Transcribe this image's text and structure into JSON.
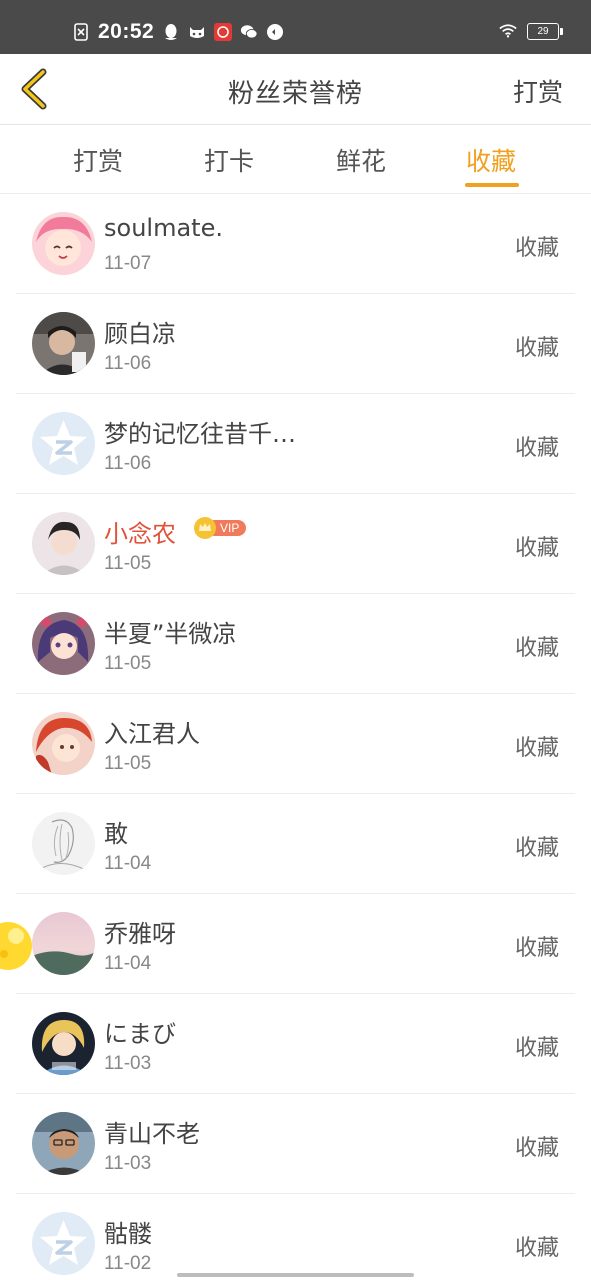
{
  "status_bar": {
    "time": "20:52",
    "battery": "29"
  },
  "header": {
    "title": "粉丝荣誉榜",
    "action": "打赏"
  },
  "tabs": [
    {
      "label": "打赏",
      "active": false
    },
    {
      "label": "打卡",
      "active": false
    },
    {
      "label": "鲜花",
      "active": false
    },
    {
      "label": "收藏",
      "active": true
    }
  ],
  "vip_label": "VIP",
  "fans": [
    {
      "name": "soulmate.",
      "date": "11-07",
      "action": "收藏"
    },
    {
      "name": "顾白凉",
      "date": "11-06",
      "action": "收藏"
    },
    {
      "name": "梦的记忆往昔千…",
      "date": "11-06",
      "action": "收藏"
    },
    {
      "name": "小念农",
      "date": "11-05",
      "action": "收藏",
      "vip": true
    },
    {
      "name": "半夏”半微凉",
      "date": "11-05",
      "action": "收藏"
    },
    {
      "name": "入江君人",
      "date": "11-05",
      "action": "收藏"
    },
    {
      "name": "敢",
      "date": "11-04",
      "action": "收藏"
    },
    {
      "name": "乔雅呀",
      "date": "11-04",
      "action": "收藏"
    },
    {
      "name": "にまび",
      "date": "11-03",
      "action": "收藏"
    },
    {
      "name": "青山不老",
      "date": "11-03",
      "action": "收藏"
    },
    {
      "name": "骷髅",
      "date": "11-02",
      "action": "收藏"
    }
  ],
  "colors": {
    "accent": "#f0a11f",
    "vip_name": "#e0533a",
    "status_bar": "#4a4a4a"
  }
}
